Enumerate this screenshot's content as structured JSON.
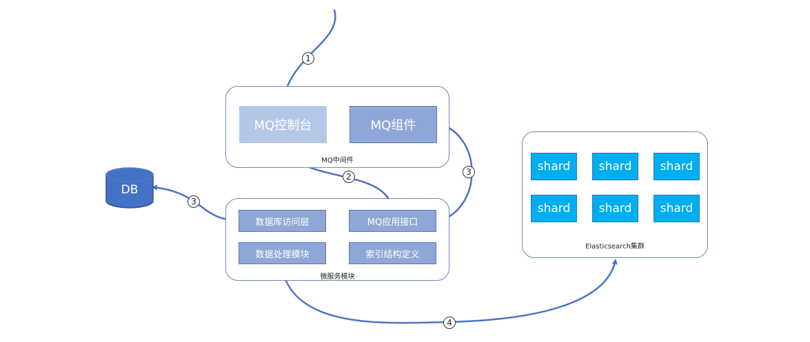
{
  "mq_middleware": {
    "label": "MQ中间件",
    "console": "MQ控制台",
    "component": "MQ组件"
  },
  "microservice": {
    "label": "微服务模块",
    "db_access": "数据库访问层",
    "mq_interface": "MQ应用接口",
    "data_processing": "数据处理模块",
    "index_definition": "索引结构定义"
  },
  "database": {
    "label": "DB"
  },
  "elasticsearch": {
    "label": "Elasticsearch集群",
    "shards": [
      "shard",
      "shard",
      "shard",
      "shard",
      "shard",
      "shard"
    ]
  },
  "steps": {
    "s1": "1",
    "s2": "2",
    "s3a": "3",
    "s3b": "3",
    "s4": "4"
  },
  "colors": {
    "arrow": "#4a72c4",
    "mq_console_fill": "#b4c7e7",
    "mq_component_fill": "#8fa7d6",
    "shard_fill": "#00aeef",
    "db_fill": "#4472c4"
  }
}
